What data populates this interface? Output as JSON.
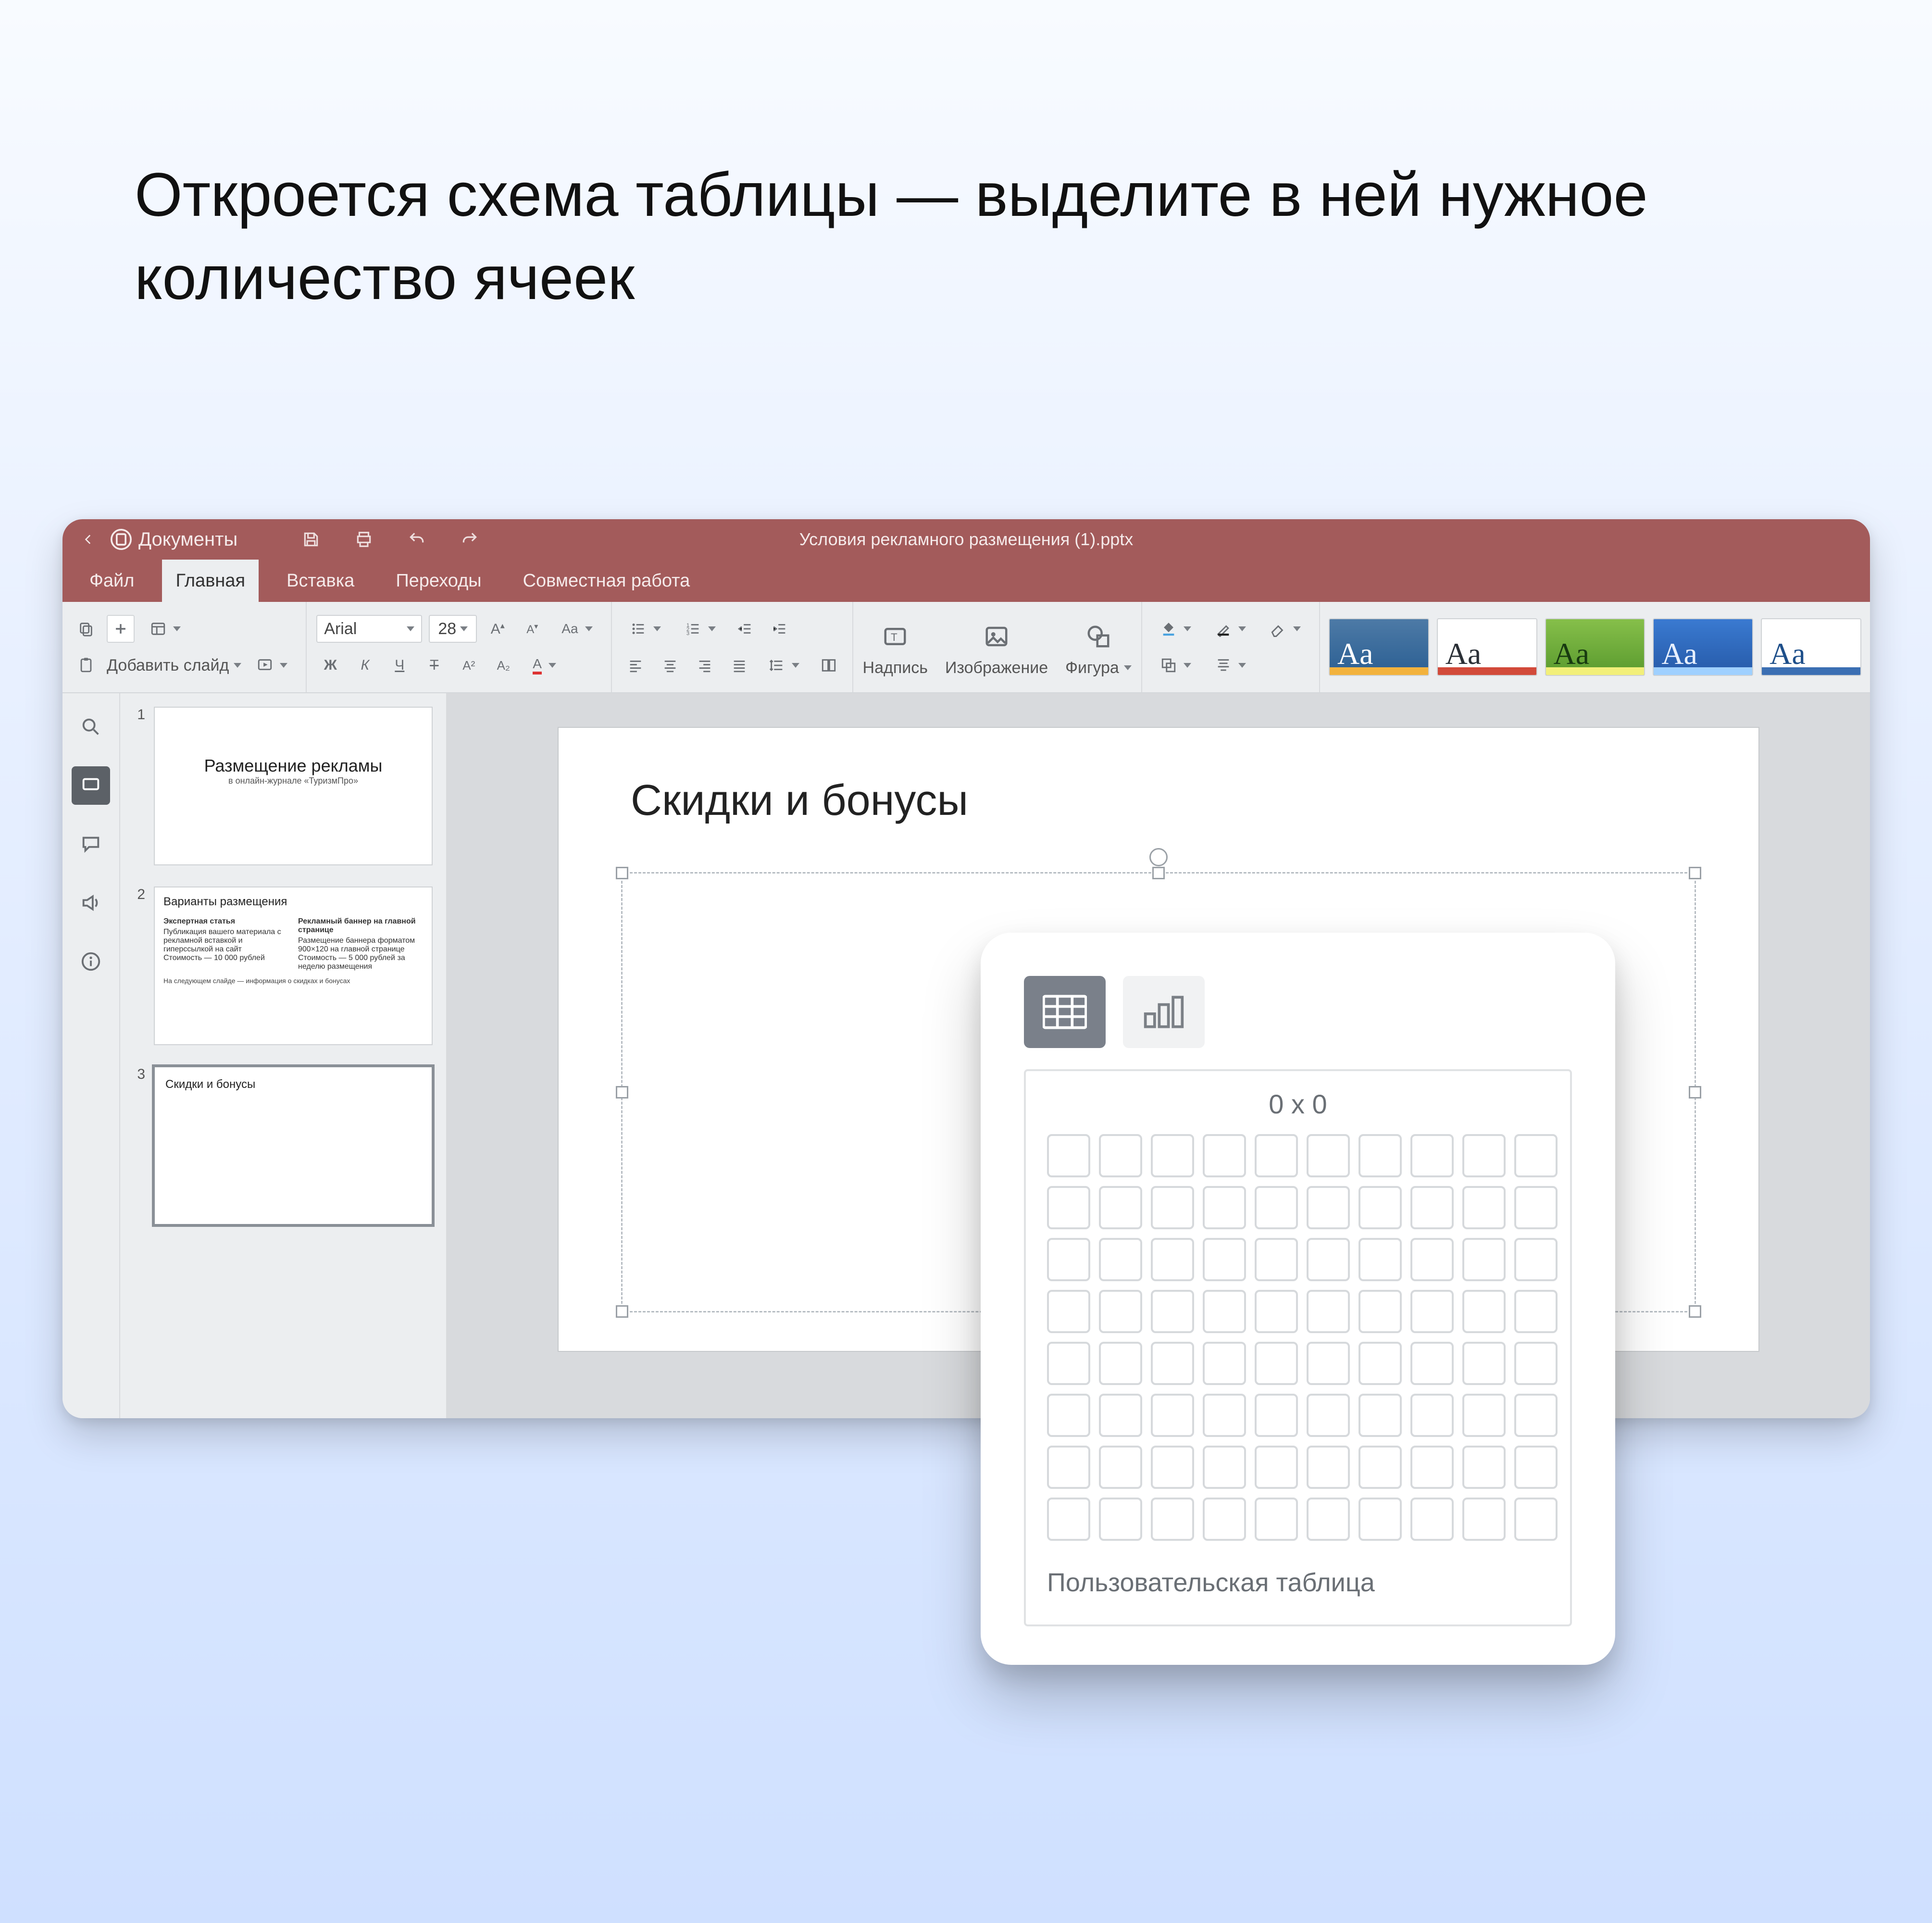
{
  "instruction": "Откроется схема таблицы — выделите в ней нужное количество ячеек",
  "titlebar": {
    "app_name": "Документы",
    "doc_title": "Условия рекламного размещения (1).pptx"
  },
  "menu": {
    "file": "Файл",
    "home": "Главная",
    "insert": "Вставка",
    "transitions": "Переходы",
    "collaborate": "Совместная работа"
  },
  "ribbon": {
    "add_slide": "Добавить слайд",
    "font_name": "Arial",
    "font_size": "28",
    "textbox": "Надпись",
    "image": "Изображение",
    "shape": "Фигура"
  },
  "themes": {
    "aa": "Aa"
  },
  "thumbs": {
    "n1": "1",
    "n2": "2",
    "n3": "3",
    "t1_title": "Размещение рекламы",
    "t1_sub": "в онлайн-журнале «ТуризмПро»",
    "t2_title": "Варианты размещения",
    "t2_col1_h": "Экспертная статья",
    "t2_col1_b1": "Публикация вашего материала с рекламной вставкой и гиперссылкой на сайт",
    "t2_col1_b2": "Стоимость — 10 000 рублей",
    "t2_col2_h": "Рекламный баннер на главной странице",
    "t2_col2_b1": "Размещение баннера форматом 900×120 на главной странице",
    "t2_col2_b2": "Стоимость — 5 000 рублей за неделю размещения",
    "t2_foot": "На следующем слайде — информация о скидках и бонусах",
    "t3_title": "Скидки и бонусы"
  },
  "slide": {
    "title": "Скидки и бонусы"
  },
  "popup": {
    "grid_size": "0 x 0",
    "custom_table": "Пользовательская таблица",
    "cols": 10,
    "rows": 8
  }
}
